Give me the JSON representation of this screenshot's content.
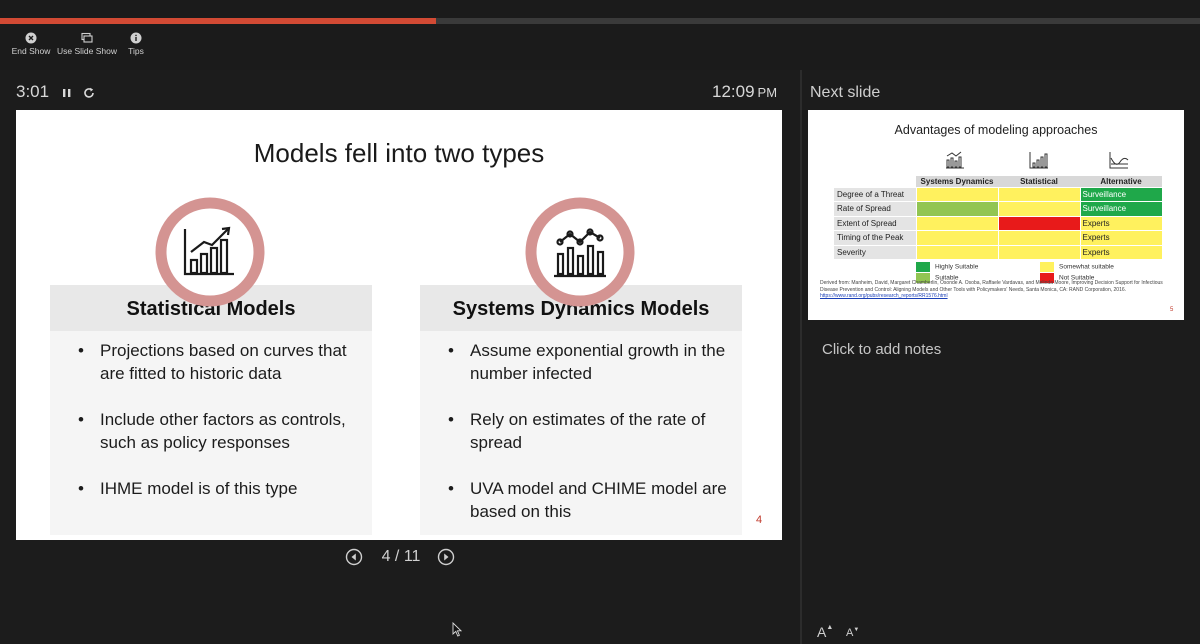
{
  "toolbar": {
    "end_show": "End Show",
    "use_slide_show": "Use Slide Show",
    "tips": "Tips"
  },
  "progress": 0.363,
  "timer": "3:01",
  "clock": {
    "time": "12:09",
    "ampm": "PM"
  },
  "slide": {
    "title": "Models fell into two types",
    "left": {
      "heading": "Statistical Models",
      "bullets": [
        "Projections based on curves that are fitted to historic data",
        "Include other factors as controls, such as policy responses",
        "IHME model is of this type"
      ]
    },
    "right": {
      "heading": "Systems Dynamics Models",
      "bullets": [
        "Assume exponential growth in the number infected",
        "Rely on estimates of the rate of spread",
        "UVA model and CHIME model are based on this"
      ]
    },
    "number": "4"
  },
  "nav": {
    "counter": "4 / 11"
  },
  "next_slide": {
    "label": "Next slide",
    "title": "Advantages of modeling approaches",
    "columns": [
      "Systems Dynamics",
      "Statistical",
      "Alternative"
    ],
    "rows": [
      {
        "label": "Degree of a Threat",
        "alt": "Surveillance"
      },
      {
        "label": "Rate of Spread",
        "alt": "Surveillance"
      },
      {
        "label": "Extent of Spread",
        "alt": "Experts"
      },
      {
        "label": "Timing of the Peak",
        "alt": "Experts"
      },
      {
        "label": "Severity",
        "alt": "Experts"
      }
    ],
    "legend": {
      "highly": "Highly Suitable",
      "suitable": "Suitable",
      "somewhat": "Somewhat suitable",
      "not": "Not Suitable"
    },
    "colors": {
      "highly": "#1fa84a",
      "suitable": "#92c552",
      "somewhat": "#fff15e",
      "not": "#e81a1a"
    },
    "source": "Derived from: Manheim, David, Margaret Chamberlin, Osonde A. Osoba, Raffaele Vardavas, and Melinda Moore, Improving Decision Support for Infectious Disease Prevention and Control: Aligning Models and Other Tools with Policymakers' Needs, Santa Monica, CA: RAND Corporation, 2016.",
    "source_link": "https://www.rand.org/pubs/research_reports/RR1576.html",
    "number": "5"
  },
  "notes": {
    "placeholder": "Click to add notes"
  },
  "font_controls": {
    "increase": "A",
    "decrease": "A"
  },
  "accent_color": "#d24a34"
}
